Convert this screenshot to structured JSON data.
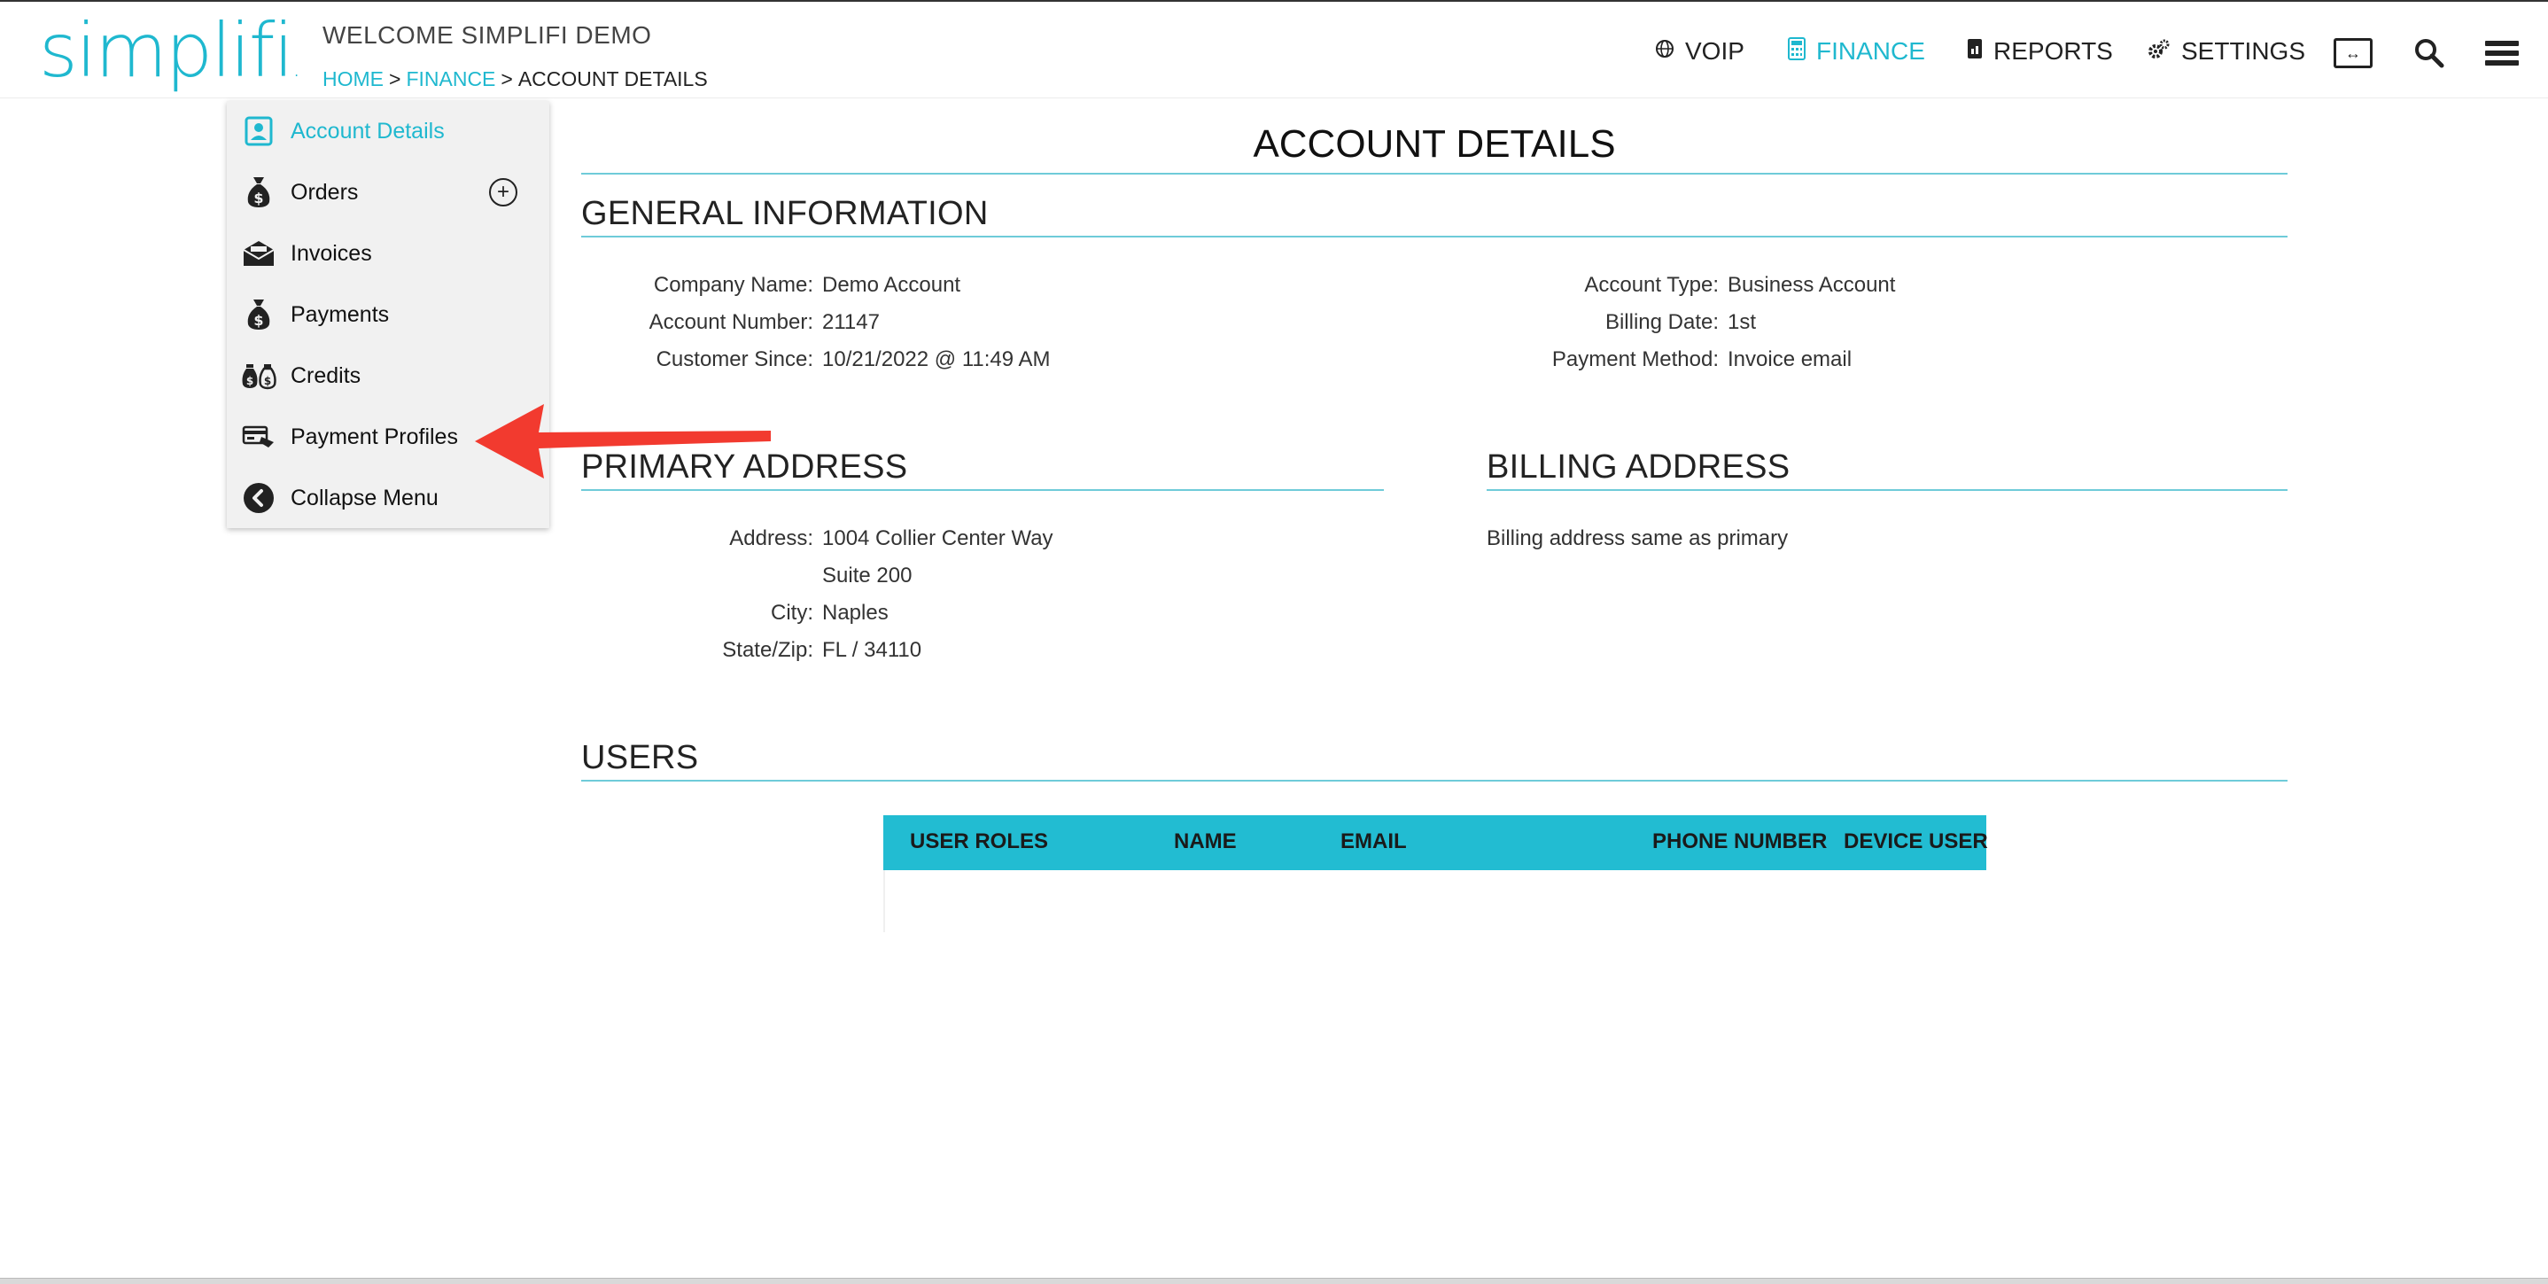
{
  "header": {
    "logo_text": "simplifi",
    "logo_dot": ".",
    "welcome": "WELCOME SIMPLIFI DEMO",
    "breadcrumb": {
      "home": "HOME",
      "finance": "FINANCE",
      "current": "ACCOUNT DETAILS",
      "separator": ">"
    },
    "nav": {
      "voip": "VOIP",
      "finance": "FINANCE",
      "reports": "REPORTS",
      "settings": "SETTINGS"
    },
    "icons": [
      "globe-icon",
      "calculator-icon",
      "report-icon",
      "gears-icon",
      "expand-icon",
      "search-icon",
      "hamburger-menu-icon"
    ]
  },
  "sidemenu": {
    "items": [
      {
        "label": "Account Details",
        "icon": "account-card-icon",
        "active": true
      },
      {
        "label": "Orders",
        "icon": "money-bag-icon",
        "active": false
      },
      {
        "label": "Invoices",
        "icon": "envelope-icon",
        "active": false
      },
      {
        "label": "Payments",
        "icon": "money-bag-icon",
        "active": false
      },
      {
        "label": "Credits",
        "icon": "money-bags-icon",
        "active": false
      },
      {
        "label": "Payment Profiles",
        "icon": "credit-card-icon",
        "active": false
      },
      {
        "label": "Collapse Menu",
        "icon": "chevron-left-circle-icon",
        "active": false
      }
    ],
    "add_order_symbol": "+"
  },
  "main": {
    "title": "ACCOUNT DETAILS",
    "general": {
      "title": "GENERAL INFORMATION",
      "company_name_label": "Company Name:",
      "company_name": "Demo Account",
      "account_number_label": "Account Number:",
      "account_number": "21147",
      "customer_since_label": "Customer Since:",
      "customer_since": "10/21/2022 @ 11:49 AM",
      "account_type_label": "Account Type:",
      "account_type": "Business Account",
      "billing_date_label": "Billing Date:",
      "billing_date": "1st",
      "payment_method_label": "Payment Method:",
      "payment_method": "Invoice email"
    },
    "primary_address": {
      "title": "PRIMARY ADDRESS",
      "address_label": "Address:",
      "address_line1": "1004 Collier Center Way",
      "address_line2": "Suite 200",
      "city_label": "City:",
      "city": "Naples",
      "state_zip_label": "State/Zip:",
      "state_zip": "FL / 34110"
    },
    "billing_address": {
      "title": "BILLING ADDRESS",
      "note": "Billing address same as primary"
    },
    "users": {
      "title": "USERS",
      "columns": [
        "USER ROLES",
        "NAME",
        "EMAIL",
        "PHONE NUMBER",
        "DEVICE USER"
      ]
    }
  },
  "colors": {
    "accent": "#1fb8cf",
    "table_header": "#22bcd2",
    "rule": "#6fcbd9",
    "arrow": "#f23a2f",
    "menu_bg": "#f1f1f1"
  }
}
